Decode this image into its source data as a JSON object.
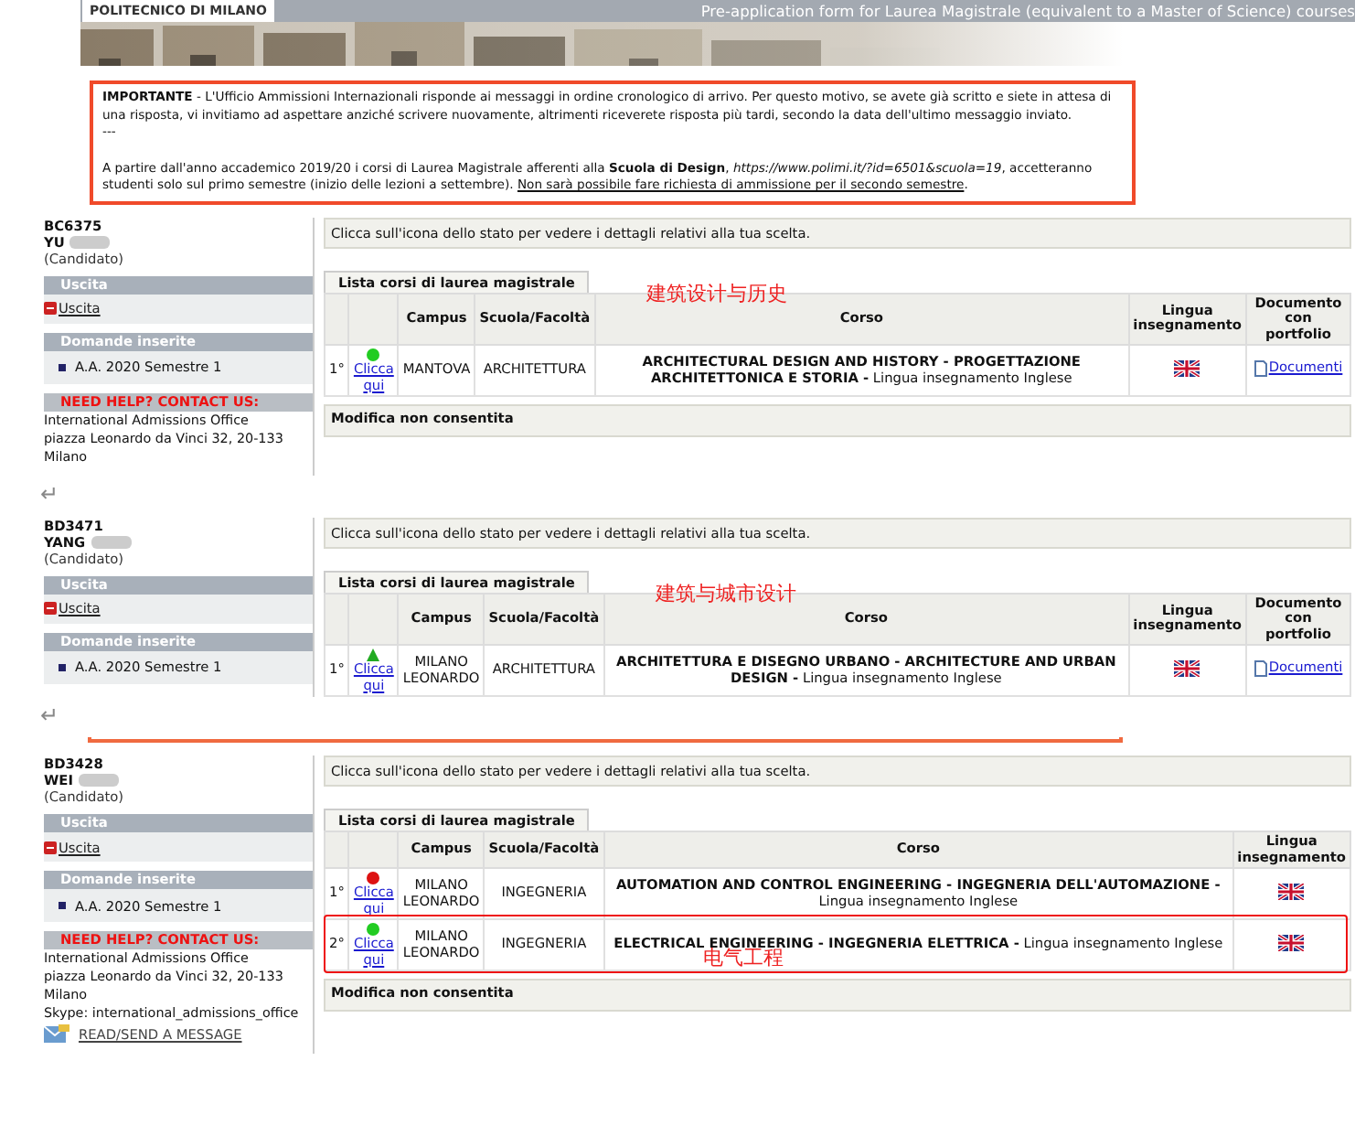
{
  "header": {
    "institution": "POLITECNICO DI MILANO",
    "form_title": "Pre-application form for Laurea Magistrale (equivalent to a Master of Science) courses"
  },
  "notice": {
    "paragraphs": [
      "**IMPORTANTE** - L'Ufficio Ammissioni Internazionali risponde ai messaggi in ordine cronologico di arrivo. Per questo motivo, se avete già scritto e siete in attesa di una risposta, vi invitiamo ad aspettare anziché scrivere nuovamente, altrimenti riceverete risposta più tardi, secondo la data dell'ultimo messaggio inviato.",
      "---"
    ],
    "closing": "A partire dall'anno accademico 2019/20 i corsi di Laurea Magistrale afferenti alla **Scuola di Design**, *https://www.polimi.it/?id=6501&scuola=19*, accetteranno studenti solo sul primo semestre (inizio delle lezioni a settembre).",
    "closing_link": "Non sarà possibile fare richiesta di ammissione per il secondo semestre",
    "closing_end": "."
  },
  "panels": [
    {
      "student": {
        "code": "BC6375",
        "name": "YU",
        "role": "(Candidato)"
      },
      "sections": [
        {
          "kind": "exit",
          "title": "Uscita",
          "items": [
            "Uscita"
          ]
        },
        {
          "kind": "list",
          "title": "Domande inserite",
          "items": [
            "A.A. 2020 Semestre 1"
          ]
        },
        {
          "kind": "help",
          "title": "NEED HELP? CONTACT US:",
          "items": [
            "International Admissions Office",
            "piazza Leonardo da Vinci 32, 20-133",
            "Milano"
          ]
        }
      ],
      "info": "Clicca sull'icona dello stato per vedere i dettagli relativi alla tua scelta.",
      "tab": "Lista corsi di laurea magistrale",
      "columns": [
        "",
        "",
        "Campus",
        "Scuola/Facoltà",
        "Corso",
        "Lingua insegnamento",
        "Documento con portfolio"
      ],
      "rows": [
        {
          "number": "1°",
          "status": {
            "kind": "dot",
            "color": "#22cc22"
          },
          "link": "Clicca qui",
          "campus": "MANTOVA",
          "school": "ARCHITETTURA",
          "course": "ARCHITECTURAL DESIGN AND HISTORY - PROGETTAZIONE ARCHITETTONICA E STORIA -",
          "course_note": "Lingua insegnamento Inglese",
          "document": "Documenti",
          "highlighted": false
        }
      ],
      "footer": "Modifica non consentita",
      "annotation": "建筑设计与历史",
      "separator": "↵"
    },
    {
      "student": {
        "code": "BD3471",
        "name": "YANG",
        "role": "(Candidato)"
      },
      "sections": [
        {
          "kind": "exit",
          "title": "Uscita",
          "items": [
            "Uscita"
          ]
        },
        {
          "kind": "list",
          "title": "Domande inserite",
          "items": [
            "A.A. 2020 Semestre 1"
          ]
        }
      ],
      "info": "Clicca sull'icona dello stato per vedere i dettagli relativi alla tua scelta.",
      "tab": "Lista corsi di laurea magistrale",
      "columns": [
        "",
        "",
        "Campus",
        "Scuola/Facoltà",
        "Corso",
        "Lingua insegnamento",
        "Documento con portfolio"
      ],
      "rows": [
        {
          "number": "1°",
          "status": {
            "kind": "triangle",
            "color": "#22aa22"
          },
          "link": "Clicca qui",
          "campus": "MILANO LEONARDO",
          "school": "ARCHITETTURA",
          "course": "ARCHITETTURA E DISEGNO URBANO - ARCHITECTURE AND URBAN DESIGN -",
          "course_note": "Lingua insegnamento Inglese",
          "document": "Documenti",
          "highlighted": false
        }
      ],
      "annotation": "建筑与城市设计",
      "separator": "↵"
    },
    {
      "student": {
        "code": "BD3428",
        "name": "WEI",
        "role": "(Candidato)"
      },
      "sections": [
        {
          "kind": "exit",
          "title": "Uscita",
          "items": [
            "Uscita"
          ]
        },
        {
          "kind": "list",
          "title": "Domande inserite",
          "items": [
            "A.A. 2020 Semestre 1"
          ]
        },
        {
          "kind": "help",
          "title": "NEED HELP? CONTACT US:",
          "items": [
            "International Admissions Office",
            "piazza Leonardo da Vinci 32, 20-133",
            "Milano",
            "Skype: international_admissions_office"
          ],
          "message": "READ/SEND A MESSAGE"
        }
      ],
      "info": "Clicca sull'icona dello stato per vedere i dettagli relativi alla tua scelta.",
      "tab": "Lista corsi di laurea magistrale",
      "columns": [
        "",
        "",
        "Campus",
        "Scuola/Facoltà",
        "Corso",
        "Lingua insegnamento"
      ],
      "rows": [
        {
          "number": "1°",
          "status": {
            "kind": "dot",
            "color": "#dd1111"
          },
          "link": "Clicca qui",
          "campus": "MILANO LEONARDO",
          "school": "INGEGNERIA",
          "course": "AUTOMATION AND CONTROL ENGINEERING - INGEGNERIA DELL'AUTOMAZIONE -",
          "course_note": "Lingua insegnamento Inglese",
          "highlighted": false
        },
        {
          "number": "2°",
          "status": {
            "kind": "dot",
            "color": "#22cc22"
          },
          "link": "Clicca qui",
          "campus": "MILANO LEONARDO",
          "school": "INGEGNERIA",
          "course": "ELECTRICAL ENGINEERING - INGEGNERIA ELETTRICA -",
          "course_note": "Lingua insegnamento Inglese",
          "highlighted": true,
          "annotation": "电气工程"
        }
      ],
      "footer": "Modifica non consentita"
    }
  ]
}
